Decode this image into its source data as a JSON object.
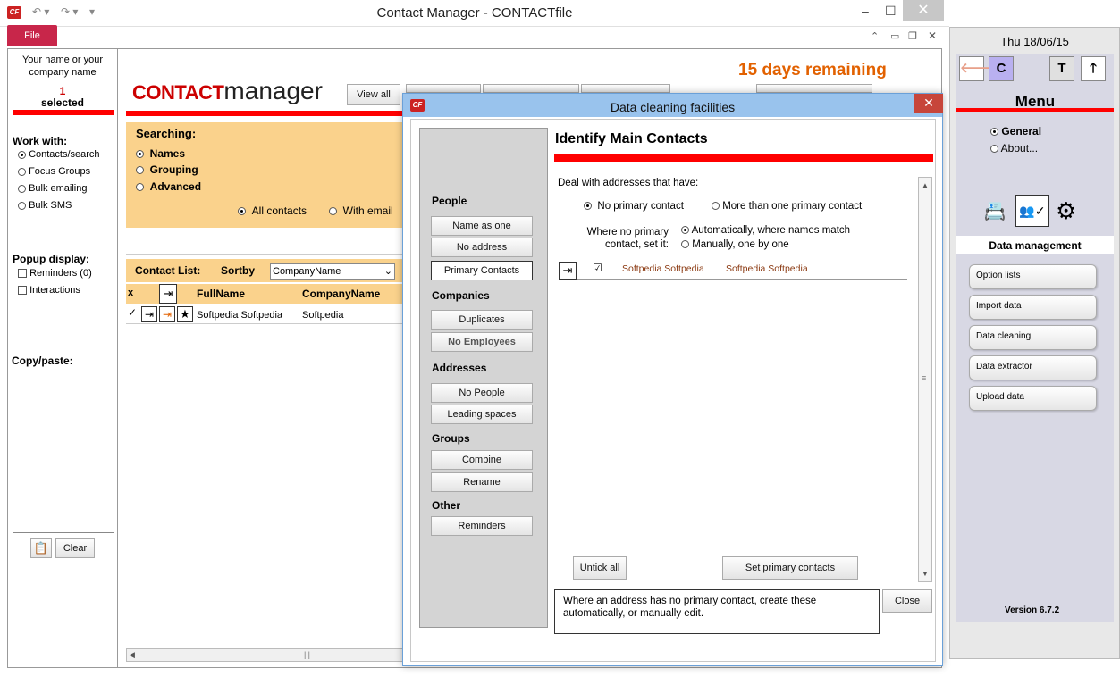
{
  "window": {
    "title": "Contact Manager  -  CONTACTfile",
    "app_icon": "CF",
    "file_tab": "File"
  },
  "left_panel": {
    "name_line1": "Your name or your",
    "name_line2": "company name",
    "selected_count": "1",
    "selected_label": "selected",
    "work_with_label": "Work with:",
    "work_with": [
      "Contacts/search",
      "Focus Groups",
      "Bulk emailing",
      "Bulk SMS"
    ],
    "popup_label": "Popup display:",
    "popup_options": [
      "Reminders (0)",
      "Interactions"
    ],
    "copy_paste_label": "Copy/paste:",
    "clear_button": "Clear"
  },
  "main": {
    "logo_contact": "CONTACT",
    "logo_manager": "manager",
    "view_all_button": "View all",
    "days_remaining": "15 days remaining",
    "searching_label": "Searching:",
    "search_modes": [
      "Names",
      "Grouping",
      "Advanced"
    ],
    "all_contacts": "All contacts",
    "with_email": "With email",
    "contact_list_label": "Contact List:",
    "sortby_label": "Sortby",
    "sortby_value": "CompanyName",
    "col_x": "x",
    "col_fullname": "FullName",
    "col_company": "CompanyName",
    "row": {
      "fullname": "Softpedia Softpedia",
      "company": "Softpedia"
    }
  },
  "dialog": {
    "title": "Data cleaning facilities",
    "heading": "Identify Main Contacts",
    "groups": {
      "people": "People",
      "companies": "Companies",
      "addresses": "Addresses",
      "groups": "Groups",
      "other": "Other"
    },
    "buttons": {
      "name_as_one": "Name as one",
      "no_address": "No address",
      "primary_contacts": "Primary Contacts",
      "duplicates": "Duplicates",
      "no_employees": "No Employees",
      "no_people": "No People",
      "leading_spaces": "Leading spaces",
      "combine": "Combine",
      "rename": "Rename",
      "reminders": "Reminders"
    },
    "deal_label": "Deal with addresses that have:",
    "no_primary": "No primary contact",
    "more_than_one": "More than one primary contact",
    "where_line1": "Where no primary",
    "where_line2": "contact, set it:",
    "auto_option": "Automatically, where names match",
    "manual_option": "Manually, one by one",
    "result_name1": "Softpedia Softpedia",
    "result_name2": "Softpedia Softpedia",
    "untick_all": "Untick all",
    "set_primary": "Set primary contacts",
    "help_text": "Where an address has no primary contact, create these automatically, or manually edit.",
    "close": "Close"
  },
  "right_panel": {
    "date": "Thu 18/06/15",
    "c_button": "C",
    "t_button": "T",
    "menu_label": "Menu",
    "general": "General",
    "about": "About...",
    "data_management": "Data management",
    "menu_buttons": [
      "Option lists",
      "Import data",
      "Data cleaning",
      "Data extractor",
      "Upload data"
    ],
    "version": "Version 6.7.2"
  },
  "colors": {
    "accent_red": "#ff0000",
    "file_tab": "#c8264a",
    "search_panel": "#fad28c",
    "days_orange": "#e26100"
  }
}
